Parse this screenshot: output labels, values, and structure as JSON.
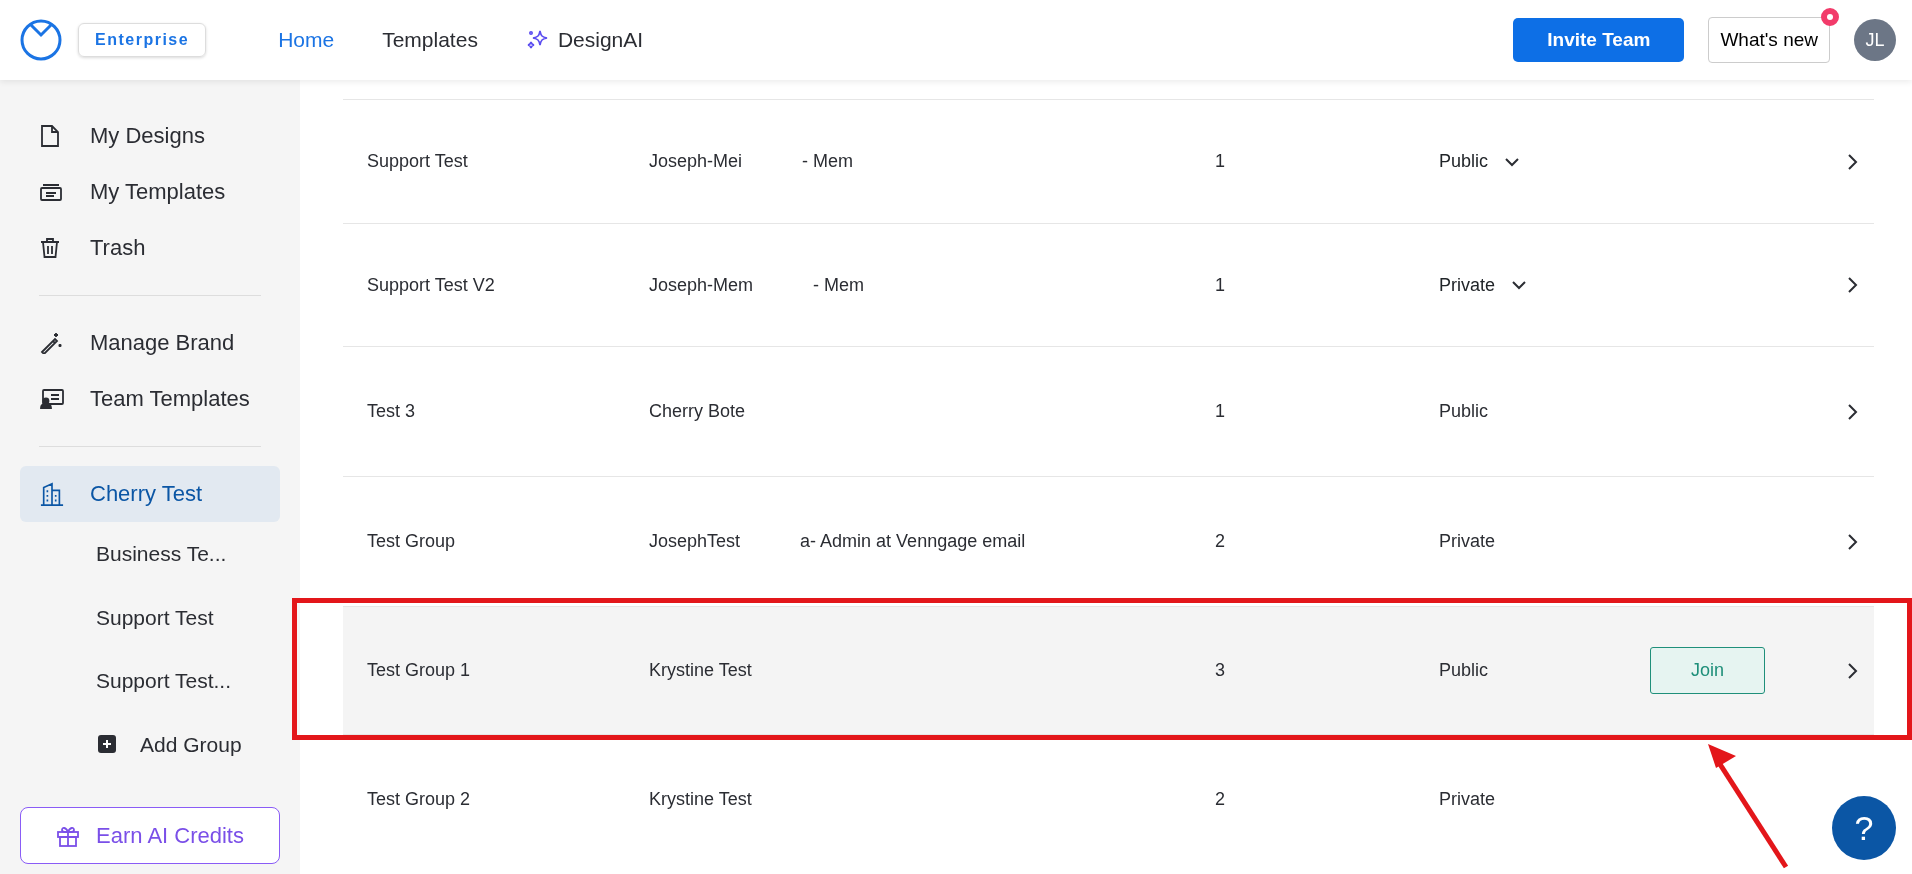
{
  "header": {
    "plan_badge": "Enterprise",
    "nav": [
      {
        "label": "Home",
        "selected": true,
        "kind": "plain"
      },
      {
        "label": "Templates",
        "selected": false,
        "kind": "plain"
      },
      {
        "label": "DesignAI",
        "selected": false,
        "kind": "sparkle"
      }
    ],
    "invite_button": "Invite Team",
    "whats_new": {
      "label": "What's new",
      "unread": true
    },
    "avatar": "JL"
  },
  "sidebar": {
    "sections": [
      [
        {
          "label": "My Designs",
          "selected": false
        },
        {
          "label": "My Templates",
          "selected": false
        },
        {
          "label": "Trash",
          "selected": false
        }
      ],
      [
        {
          "label": "Manage Brand",
          "selected": false
        },
        {
          "label": "Team Templates",
          "selected": false
        }
      ],
      [
        {
          "label": "Cherry Test",
          "selected": true,
          "children": [
            {
              "label": "Business Te..."
            },
            {
              "label": "Support Test"
            },
            {
              "label": "Support Test..."
            }
          ]
        }
      ]
    ],
    "add_group": "Add Group",
    "earn_button": "Earn AI Credits"
  },
  "table": {
    "rows": [
      {
        "name": "Support Test",
        "owner": [
          "Joseph-Mei",
          "- Mem"
        ],
        "count": "1",
        "privacy": "Public",
        "privacy_dropdown": true,
        "highlighted": false
      },
      {
        "name": "Support Test V2",
        "owner": [
          "Joseph-Mem",
          "- Mem"
        ],
        "count": "1",
        "privacy": "Private",
        "privacy_dropdown": true,
        "highlighted": false
      },
      {
        "name": "Test 3",
        "owner": [
          "Cherry Bote"
        ],
        "count": "1",
        "privacy": "Public",
        "privacy_dropdown": false,
        "highlighted": false
      },
      {
        "name": "Test Group",
        "owner": [
          "JosephTest",
          "a- Admin at Venngage email"
        ],
        "count": "2",
        "privacy": "Private",
        "privacy_dropdown": false,
        "highlighted": false
      },
      {
        "name": "Test Group 1",
        "owner": [
          "Krystine Test"
        ],
        "count": "3",
        "privacy": "Public",
        "privacy_dropdown": false,
        "highlighted": true,
        "join_button": "Join"
      },
      {
        "name": "Test Group 2",
        "owner": [
          "Krystine Test"
        ],
        "count": "2",
        "privacy": "Private",
        "privacy_dropdown": false,
        "highlighted": false,
        "chevron": false
      }
    ]
  },
  "help_button": "?"
}
